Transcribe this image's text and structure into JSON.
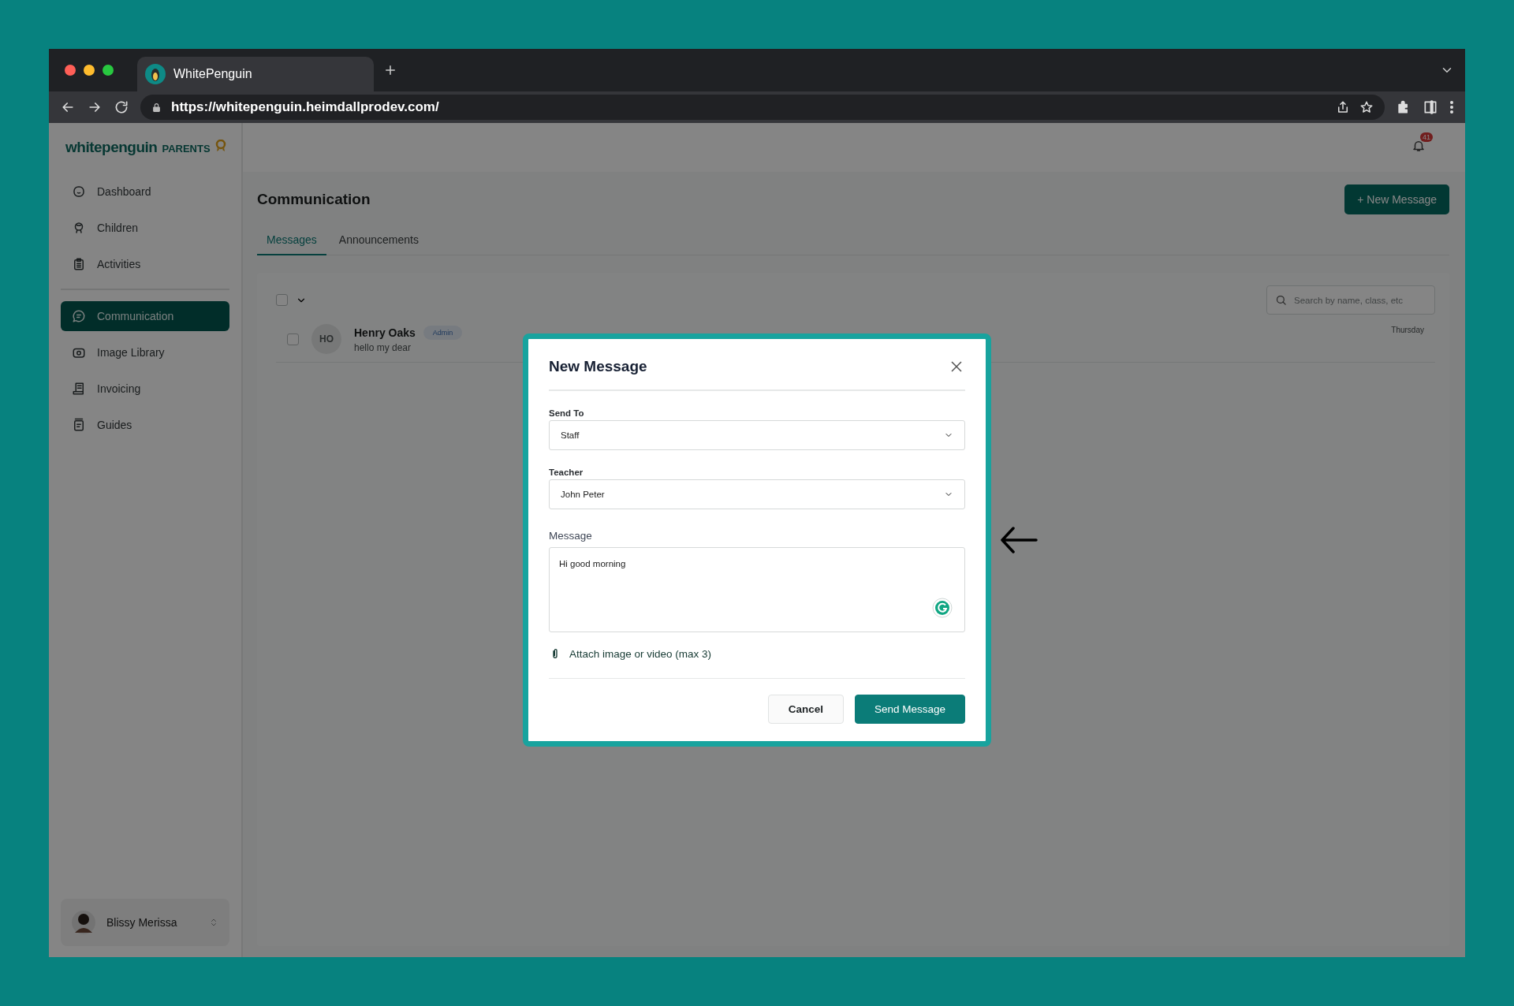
{
  "browser": {
    "tab_title": "WhitePenguin",
    "url": "https://whitepenguin.heimdallprodev.com/"
  },
  "app": {
    "brand": "whitepenguin",
    "brand_suffix": "PARENTS",
    "notification_count": "41"
  },
  "sidebar": {
    "groups": [
      [
        {
          "label": "Dashboard",
          "selected": false
        },
        {
          "label": "Children",
          "selected": false
        },
        {
          "label": "Activities",
          "selected": false
        }
      ],
      [
        {
          "label": "Communication",
          "selected": true
        },
        {
          "label": "Image Library",
          "selected": false
        },
        {
          "label": "Invoicing",
          "selected": false
        },
        {
          "label": "Guides",
          "selected": false
        }
      ]
    ]
  },
  "user": {
    "name": "Blissy Merissa"
  },
  "page": {
    "title": "Communication",
    "new_button": "+ New Message",
    "tabs": [
      {
        "label": "Messages",
        "selected": true
      },
      {
        "label": "Announcements",
        "selected": false
      }
    ],
    "select_all": {
      "checked": false
    },
    "search": {
      "placeholder": "Search by name, class, etc"
    },
    "messages": [
      {
        "initials": "HO",
        "sender": "Henry Oaks",
        "badge": "Admin",
        "preview": "hello my dear",
        "day": "Thursday",
        "checked": false
      }
    ]
  },
  "modal": {
    "title": "New Message",
    "fields": [
      {
        "kind": "select",
        "label": "Send To",
        "value": "Staff"
      },
      {
        "kind": "select",
        "label": "Teacher",
        "value": "John Peter"
      },
      {
        "kind": "textarea",
        "label": "Message",
        "value": "Hi good morning"
      }
    ],
    "attach": "Attach image or video (max 3)",
    "buttons": [
      {
        "kind": "secondary",
        "label": "Cancel"
      },
      {
        "kind": "primary",
        "label": "Send Message"
      }
    ]
  }
}
